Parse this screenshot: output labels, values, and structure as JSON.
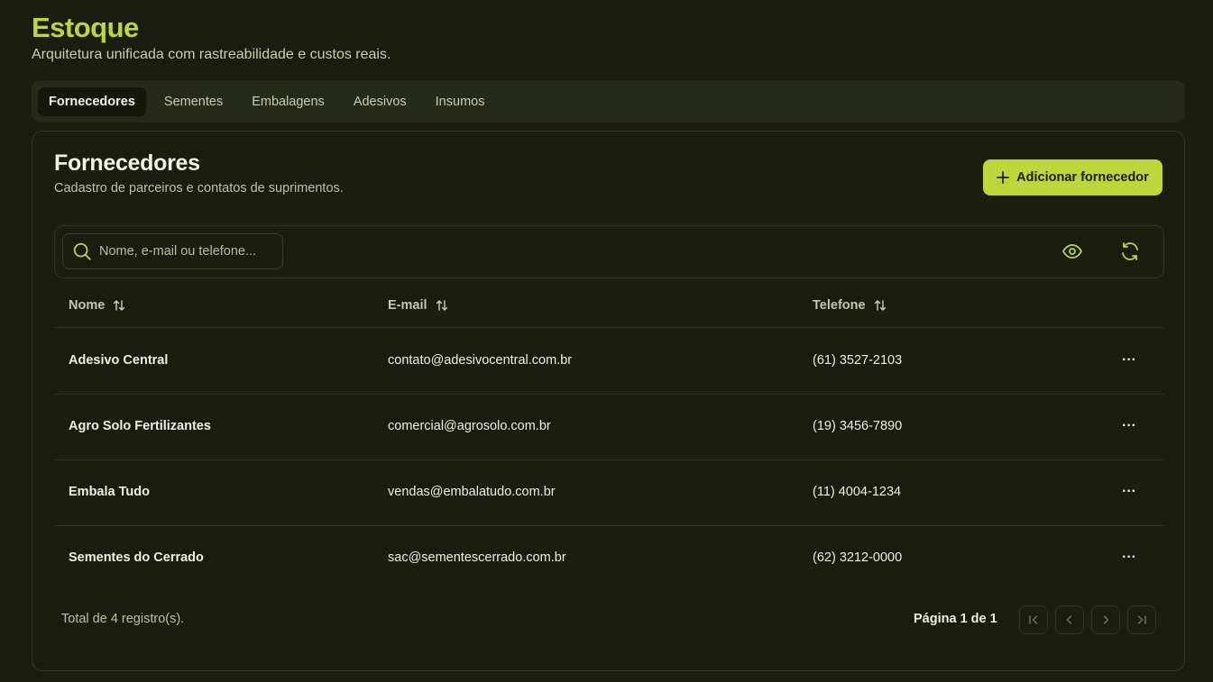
{
  "header": {
    "title": "Estoque",
    "subtitle": "Arquitetura unificada com rastreabilidade e custos reais."
  },
  "tabs": [
    {
      "label": "Fornecedores",
      "active": true
    },
    {
      "label": "Sementes",
      "active": false
    },
    {
      "label": "Embalagens",
      "active": false
    },
    {
      "label": "Adesivos",
      "active": false
    },
    {
      "label": "Insumos",
      "active": false
    }
  ],
  "card": {
    "title": "Fornecedores",
    "subtitle": "Cadastro de parceiros e contatos de suprimentos.",
    "add_button_label": "Adicionar fornecedor",
    "add_button_icon": "plus-icon"
  },
  "toolbar": {
    "search_placeholder": "Nome, e-mail ou telefone...",
    "search_value": "",
    "search_icon": "search-icon",
    "view_icon": "eye-icon",
    "refresh_icon": "refresh-icon"
  },
  "table": {
    "columns": [
      {
        "label": "Nome",
        "sort_icon": "sort-icon"
      },
      {
        "label": "E-mail",
        "sort_icon": "sort-icon"
      },
      {
        "label": "Telefone",
        "sort_icon": "sort-icon"
      }
    ],
    "rows": [
      {
        "name": "Adesivo Central",
        "email": "contato@adesivocentral.com.br",
        "phone": "(61) 3527-2103",
        "action": "···"
      },
      {
        "name": "Agro Solo Fertilizantes",
        "email": "comercial@agrosolo.com.br",
        "phone": "(19) 3456-7890",
        "action": "···"
      },
      {
        "name": "Embala Tudo",
        "email": "vendas@embalatudo.com.br",
        "phone": "(11) 4004-1234",
        "action": "···"
      },
      {
        "name": "Sementes do Cerrado",
        "email": "sac@sementescerrado.com.br",
        "phone": "(62) 3212-0000",
        "action": "···"
      }
    ]
  },
  "footer": {
    "total": "Total de 4 registro(s).",
    "page_info": "Página 1 de 1",
    "pager_icons": [
      "first-page-icon",
      "prev-page-icon",
      "next-page-icon",
      "last-page-icon"
    ]
  },
  "colors": {
    "background": "#1a1d0f",
    "accent": "#bfd63b",
    "panel": "#262a18",
    "text": "#eef2d8"
  }
}
